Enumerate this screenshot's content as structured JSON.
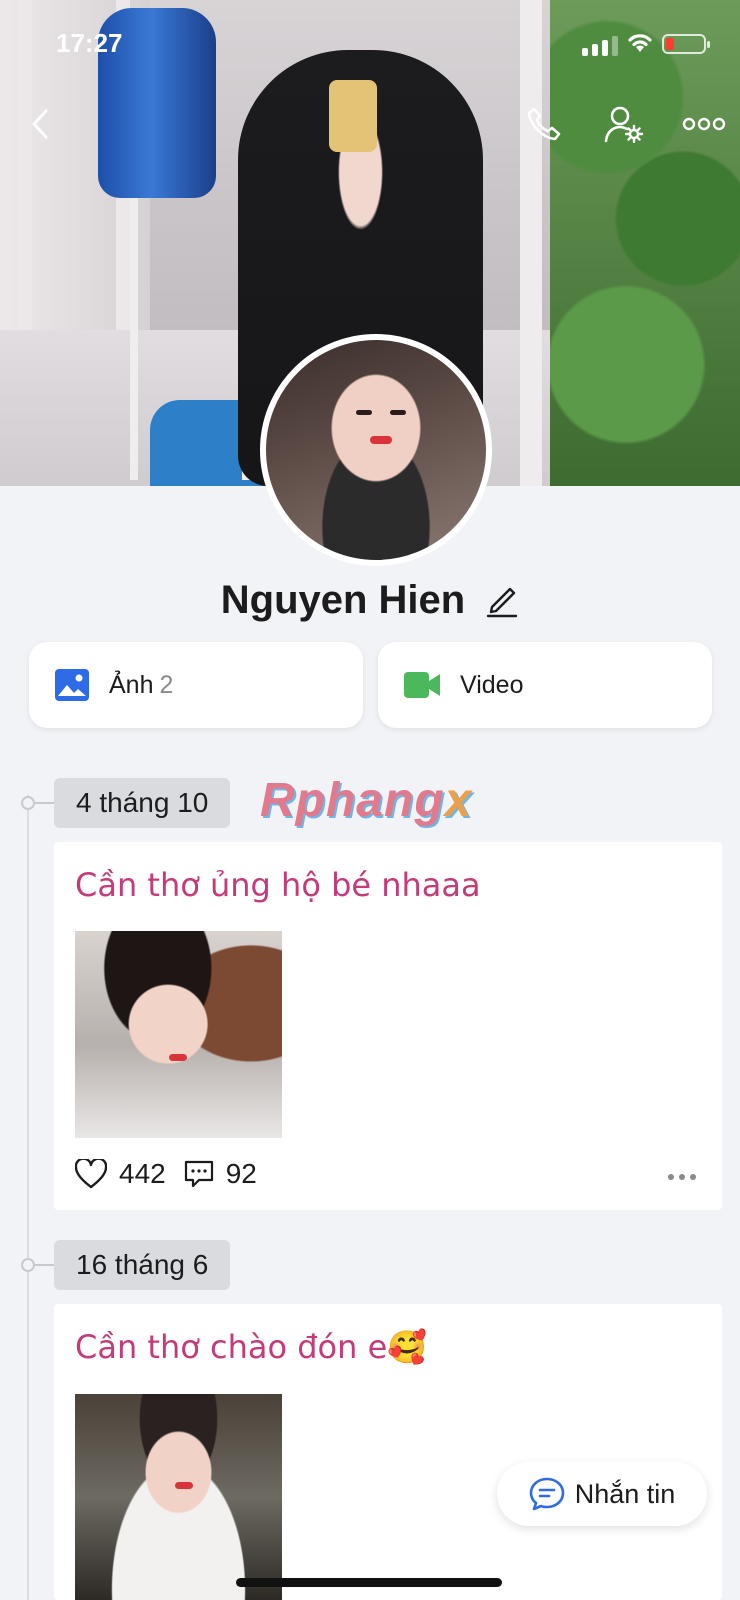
{
  "status_bar": {
    "time": "17:27"
  },
  "profile": {
    "name": "Nguyen Hien"
  },
  "media": {
    "photos_label": "Ảnh",
    "photos_count": "2",
    "video_label": "Video"
  },
  "watermark": {
    "text": "Rphang",
    "x": "x"
  },
  "posts": [
    {
      "date": "4 tháng 10",
      "text": "Cần thơ ủng hộ bé nhaaa",
      "likes": "442",
      "comments": "92"
    },
    {
      "date": "16 tháng 6",
      "text": "Cần thơ chào đón e🥰"
    }
  ],
  "message_button": {
    "label": "Nhắn tin"
  },
  "colors": {
    "accent": "#2d6ce6",
    "video": "#4cb85c",
    "post_text": "#c53a78"
  }
}
